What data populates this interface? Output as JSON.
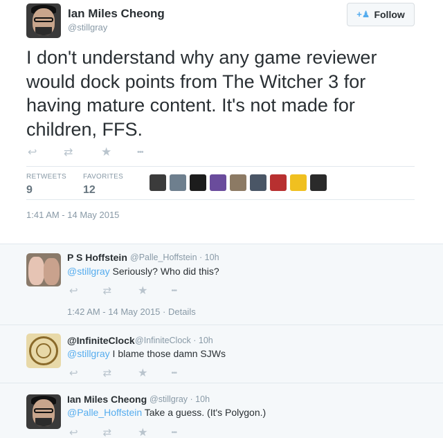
{
  "main_tweet": {
    "author_name": "Ian Miles Cheong",
    "author_handle": "@stillgray",
    "follow_label": "Follow",
    "text": "I don't understand why any game reviewer would dock points from The Witcher 3 for having mature content. It's not made for children, FFS.",
    "stats": {
      "retweets_label": "RETWEETS",
      "retweets_value": "9",
      "favorites_label": "FAVORITES",
      "favorites_value": "12"
    },
    "timestamp": "1:41 AM - 14 May 2015"
  },
  "favoriter_avatar_colors": [
    "#3b3b3b",
    "#6e7f8e",
    "#1c1c1c",
    "#6a4c9c",
    "#8c7a64",
    "#4a5666",
    "#b83030",
    "#f0c020",
    "#2a2a2a"
  ],
  "replies": [
    {
      "name": "P S Hoffstein",
      "handle": "@Palle_Hoffstein",
      "time": "· 10h",
      "mention": "@stillgray",
      "text": " Seriously? Who did this?",
      "footer": "1:42 AM - 14 May 2015 · Details"
    },
    {
      "name": "@InfiniteClock",
      "handle": "@InfiniteClock",
      "time": "· 10h",
      "mention": "@stillgray",
      "text": " I blame those damn SJWs"
    },
    {
      "name": "Ian Miles Cheong",
      "handle": "@stillgray",
      "time": "· 10h",
      "mention": "@Palle_Hoffstein",
      "text": " Take a guess. (It's Polygon.)"
    }
  ],
  "icons": {
    "reply": "↩",
    "retweet": "⇄",
    "favorite": "★",
    "more": "•••",
    "follow": "+👤"
  }
}
